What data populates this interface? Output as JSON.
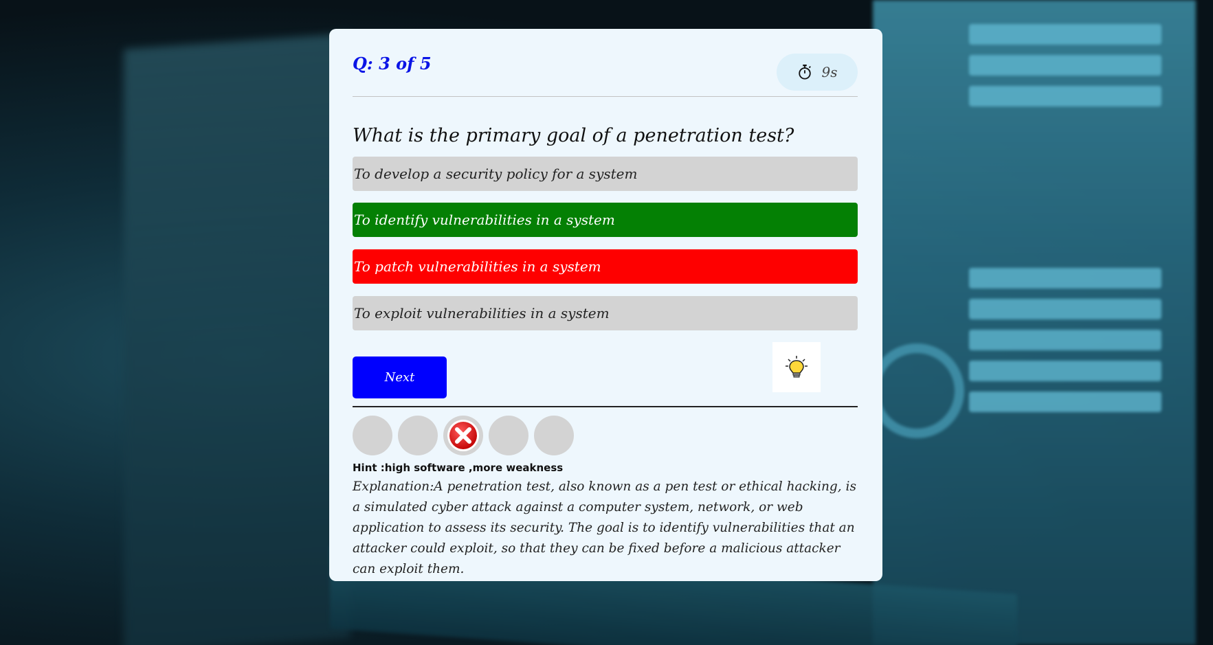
{
  "colors": {
    "counter": "#0a14e6",
    "correct_option": "#048004",
    "wrong_option": "#fe0000",
    "neutral_option": "#d3d3d3",
    "next_button": "#0000fe",
    "card": "#eef7fd"
  },
  "header": {
    "question_counter": "Q: 3 of 5",
    "timer_icon": "stopwatch-icon",
    "timer_value": "9s"
  },
  "question": {
    "text": "What is the primary goal of a penetration test?",
    "options": [
      {
        "label": "To develop a security policy for a system",
        "state": "neutral"
      },
      {
        "label": "To identify vulnerabilities in a system",
        "state": "correct"
      },
      {
        "label": "To patch vulnerabilities in a system",
        "state": "wrong"
      },
      {
        "label": "To exploit vulnerabilities in a system",
        "state": "neutral"
      }
    ]
  },
  "controls": {
    "next_label": "Next",
    "hint_icon": "lightbulb-icon"
  },
  "progress": {
    "results": [
      "unanswered",
      "unanswered",
      "wrong",
      "unanswered",
      "unanswered"
    ],
    "wrong_icon": "x-circle-icon"
  },
  "hint": "Hint :high software ,more weakness",
  "explanation": "Explanation:A penetration test, also known as a pen test or ethical hacking, is a simulated cyber attack against a computer system, network, or web application to assess its security. The goal is to identify vulnerabilities that an attacker could exploit, so that they can be fixed before a malicious attacker can exploit them."
}
